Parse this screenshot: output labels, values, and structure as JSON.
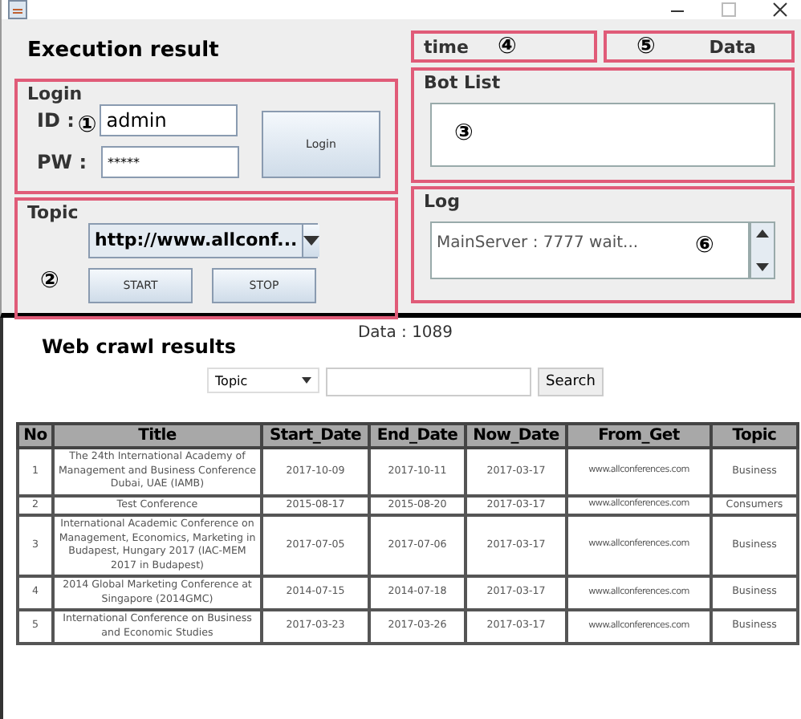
{
  "window": {
    "title": "Execution result"
  },
  "time_box": {
    "label": "time",
    "marker": "④"
  },
  "data_box": {
    "label": "Data",
    "marker": "⑤"
  },
  "login": {
    "title": "Login",
    "marker": "①",
    "id_label": "ID :",
    "id_value": "admin",
    "pw_label": "PW :",
    "pw_value": "*****",
    "button": "Login"
  },
  "topic": {
    "title": "Topic",
    "marker": "②",
    "url": "http://www.allconf...",
    "buttons": [
      "START",
      "STOP"
    ]
  },
  "bot_list": {
    "title": "Bot List",
    "marker": "③"
  },
  "log": {
    "title": "Log",
    "marker": "⑥",
    "text": "MainServer : 7777 wait..."
  },
  "web": {
    "count": "Data : 1089",
    "heading": "Web crawl results",
    "filter": "Topic",
    "search_button": "Search"
  },
  "table": {
    "columns": [
      "No",
      "Title",
      "Start_Date",
      "End_Date",
      "Now_Date",
      "From_Get",
      "Topic"
    ],
    "rows": [
      [
        "1",
        "The 24th International Academy of Management and Business Conference Dubai, UAE (IAMB)",
        "2017-10-09",
        "2017-10-11",
        "2017-03-17",
        "www.allconferences.com",
        "Business"
      ],
      [
        "2",
        "Test Conference",
        "2015-08-17",
        "2015-08-20",
        "2017-03-17",
        "www.allconferences.com",
        "Consumers"
      ],
      [
        "3",
        "International Academic Conference on Management, Economics, Marketing in Budapest, Hungary 2017 (IAC-MEM 2017 in Budapest)",
        "2017-07-05",
        "2017-07-06",
        "2017-03-17",
        "www.allconferences.com",
        "Business"
      ],
      [
        "4",
        "2014 Global Marketing Conference at Singapore (2014GMC)",
        "2014-07-15",
        "2014-07-18",
        "2017-03-17",
        "www.allconferences.com",
        "Business"
      ],
      [
        "5",
        "International Conference on Business and Economic Studies",
        "2017-03-23",
        "2017-03-26",
        "2017-03-17",
        "www.allconferences.com",
        "Business"
      ]
    ]
  }
}
